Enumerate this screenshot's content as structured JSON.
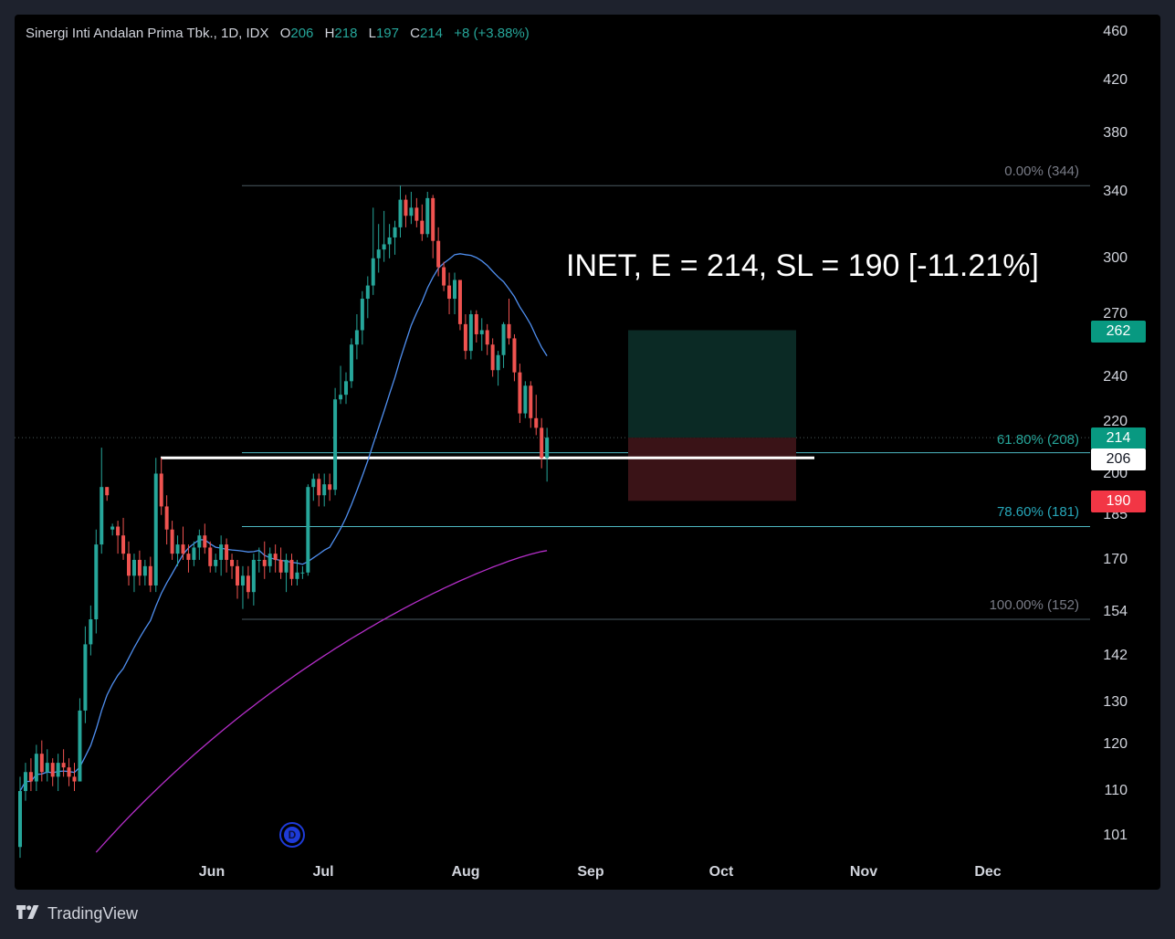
{
  "legend": {
    "symbol": "Sinergi Inti Andalan Prima Tbk., 1D, IDX",
    "o_key": "O",
    "o_val": "206",
    "h_key": "H",
    "h_val": "218",
    "l_key": "L",
    "l_val": "197",
    "c_key": "C",
    "c_val": "214",
    "change": "+8 (+3.88%)"
  },
  "annotation": "INET, E = 214, SL = 190 [-11.21%]",
  "brand": "TradingView",
  "event_marker": "D",
  "price_tags": {
    "target": "262",
    "entry": "214",
    "level": "206",
    "stop": "190"
  },
  "fib_labels": {
    "f0": "0.00% (344)",
    "f618": "61.80% (208)",
    "f786": "78.60% (181)",
    "f100": "100.00% (152)"
  },
  "colors": {
    "up": "#26a69a",
    "down": "#ef5350",
    "ma_fast": "#4f8ff0",
    "ma_slow": "#b52ec9",
    "fib_line": "#4db6c0",
    "target_zone": "#0b2a25",
    "stop_zone": "#3a1317"
  },
  "chart_data": {
    "type": "candlestick",
    "title": "Sinergi Inti Andalan Prima Tbk., 1D, IDX",
    "last": {
      "open": 206,
      "high": 218,
      "low": 197,
      "close": 214,
      "change": 8,
      "change_pct": 3.88
    },
    "y_ticks": [
      "460",
      "420",
      "380",
      "340",
      "300",
      "270",
      "240",
      "220",
      "200",
      "185",
      "170",
      "154",
      "142",
      "130",
      "120",
      "110",
      "101"
    ],
    "x_ticks": [
      "Jun",
      "Jul",
      "Aug",
      "Sep",
      "Oct",
      "Nov",
      "Dec"
    ],
    "log_scale": true,
    "grid": false,
    "candles": [
      [
        99,
        113,
        97,
        110
      ],
      [
        110,
        116,
        108,
        114
      ],
      [
        114,
        117,
        110,
        112
      ],
      [
        112,
        120,
        110,
        118
      ],
      [
        118,
        121,
        112,
        114
      ],
      [
        114,
        119,
        112,
        116
      ],
      [
        116,
        117,
        111,
        113
      ],
      [
        113,
        118,
        110,
        116
      ],
      [
        116,
        119,
        113,
        115
      ],
      [
        115,
        117,
        111,
        113
      ],
      [
        113,
        116,
        110,
        112
      ],
      [
        112,
        131,
        112,
        128
      ],
      [
        128,
        150,
        125,
        145
      ],
      [
        145,
        156,
        142,
        152
      ],
      [
        152,
        180,
        148,
        175
      ],
      [
        175,
        210,
        172,
        195
      ],
      [
        195,
        195,
        190,
        192
      ],
      [
        180,
        182,
        178,
        181
      ],
      [
        181,
        183,
        172,
        178
      ],
      [
        178,
        184,
        170,
        172
      ],
      [
        172,
        176,
        162,
        165
      ],
      [
        165,
        172,
        160,
        170
      ],
      [
        170,
        173,
        162,
        165
      ],
      [
        165,
        170,
        162,
        168
      ],
      [
        168,
        171,
        160,
        162
      ],
      [
        162,
        206,
        160,
        200
      ],
      [
        200,
        206,
        185,
        188
      ],
      [
        188,
        192,
        175,
        180
      ],
      [
        180,
        183,
        170,
        172
      ],
      [
        172,
        178,
        168,
        175
      ],
      [
        175,
        181,
        170,
        172
      ],
      [
        172,
        175,
        166,
        170
      ],
      [
        170,
        176,
        168,
        174
      ],
      [
        174,
        180,
        170,
        178
      ],
      [
        178,
        182,
        172,
        174
      ],
      [
        174,
        176,
        166,
        168
      ],
      [
        168,
        172,
        166,
        170
      ],
      [
        170,
        178,
        165,
        175
      ],
      [
        175,
        177,
        166,
        170
      ],
      [
        170,
        172,
        164,
        168
      ],
      [
        168,
        170,
        158,
        162
      ],
      [
        162,
        168,
        155,
        165
      ],
      [
        165,
        168,
        158,
        160
      ],
      [
        160,
        172,
        156,
        170
      ],
      [
        170,
        174,
        166,
        170
      ],
      [
        170,
        176,
        164,
        168
      ],
      [
        168,
        174,
        166,
        172
      ],
      [
        172,
        175,
        166,
        170
      ],
      [
        170,
        174,
        164,
        166
      ],
      [
        166,
        172,
        160,
        170
      ],
      [
        170,
        172,
        162,
        164
      ],
      [
        164,
        170,
        162,
        166
      ],
      [
        166,
        168,
        164,
        166
      ],
      [
        166,
        196,
        165,
        195
      ],
      [
        195,
        200,
        190,
        198
      ],
      [
        198,
        200,
        188,
        192
      ],
      [
        192,
        200,
        188,
        196
      ],
      [
        196,
        200,
        190,
        194
      ],
      [
        194,
        235,
        192,
        230
      ],
      [
        230,
        245,
        228,
        232
      ],
      [
        232,
        242,
        228,
        238
      ],
      [
        238,
        258,
        235,
        255
      ],
      [
        255,
        270,
        248,
        262
      ],
      [
        262,
        282,
        255,
        278
      ],
      [
        278,
        290,
        268,
        285
      ],
      [
        285,
        330,
        280,
        300
      ],
      [
        300,
        320,
        292,
        305
      ],
      [
        305,
        328,
        298,
        308
      ],
      [
        308,
        320,
        300,
        312
      ],
      [
        312,
        322,
        302,
        318
      ],
      [
        318,
        344,
        312,
        335
      ],
      [
        335,
        338,
        318,
        325
      ],
      [
        325,
        340,
        320,
        330
      ],
      [
        330,
        336,
        318,
        322
      ],
      [
        322,
        332,
        310,
        314
      ],
      [
        314,
        340,
        312,
        336
      ],
      [
        336,
        338,
        300,
        310
      ],
      [
        310,
        318,
        290,
        295
      ],
      [
        295,
        298,
        282,
        285
      ],
      [
        285,
        292,
        270,
        278
      ],
      [
        278,
        292,
        270,
        288
      ],
      [
        288,
        288,
        262,
        265
      ],
      [
        265,
        270,
        248,
        252
      ],
      [
        252,
        272,
        248,
        270
      ],
      [
        270,
        272,
        256,
        260
      ],
      [
        260,
        268,
        252,
        262
      ],
      [
        262,
        265,
        250,
        255
      ],
      [
        255,
        258,
        240,
        243
      ],
      [
        243,
        252,
        236,
        250
      ],
      [
        250,
        266,
        244,
        265
      ],
      [
        265,
        278,
        255,
        258
      ],
      [
        258,
        260,
        238,
        242
      ],
      [
        242,
        246,
        220,
        224
      ],
      [
        224,
        238,
        222,
        236
      ],
      [
        236,
        238,
        218,
        222
      ],
      [
        222,
        232,
        215,
        218
      ],
      [
        218,
        222,
        202,
        206
      ],
      [
        206,
        218,
        197,
        214
      ]
    ],
    "ma_fast_label": "short moving average",
    "ma_slow_label": "long moving average",
    "fibonacci": [
      {
        "level": "0.00%",
        "price": 344
      },
      {
        "level": "61.80%",
        "price": 208
      },
      {
        "level": "78.60%",
        "price": 181
      },
      {
        "level": "100.00%",
        "price": 152
      }
    ],
    "position": {
      "entry": 214,
      "target": 262,
      "stop": 190,
      "stop_pct": -11.21
    },
    "horizontal_level": 206
  }
}
